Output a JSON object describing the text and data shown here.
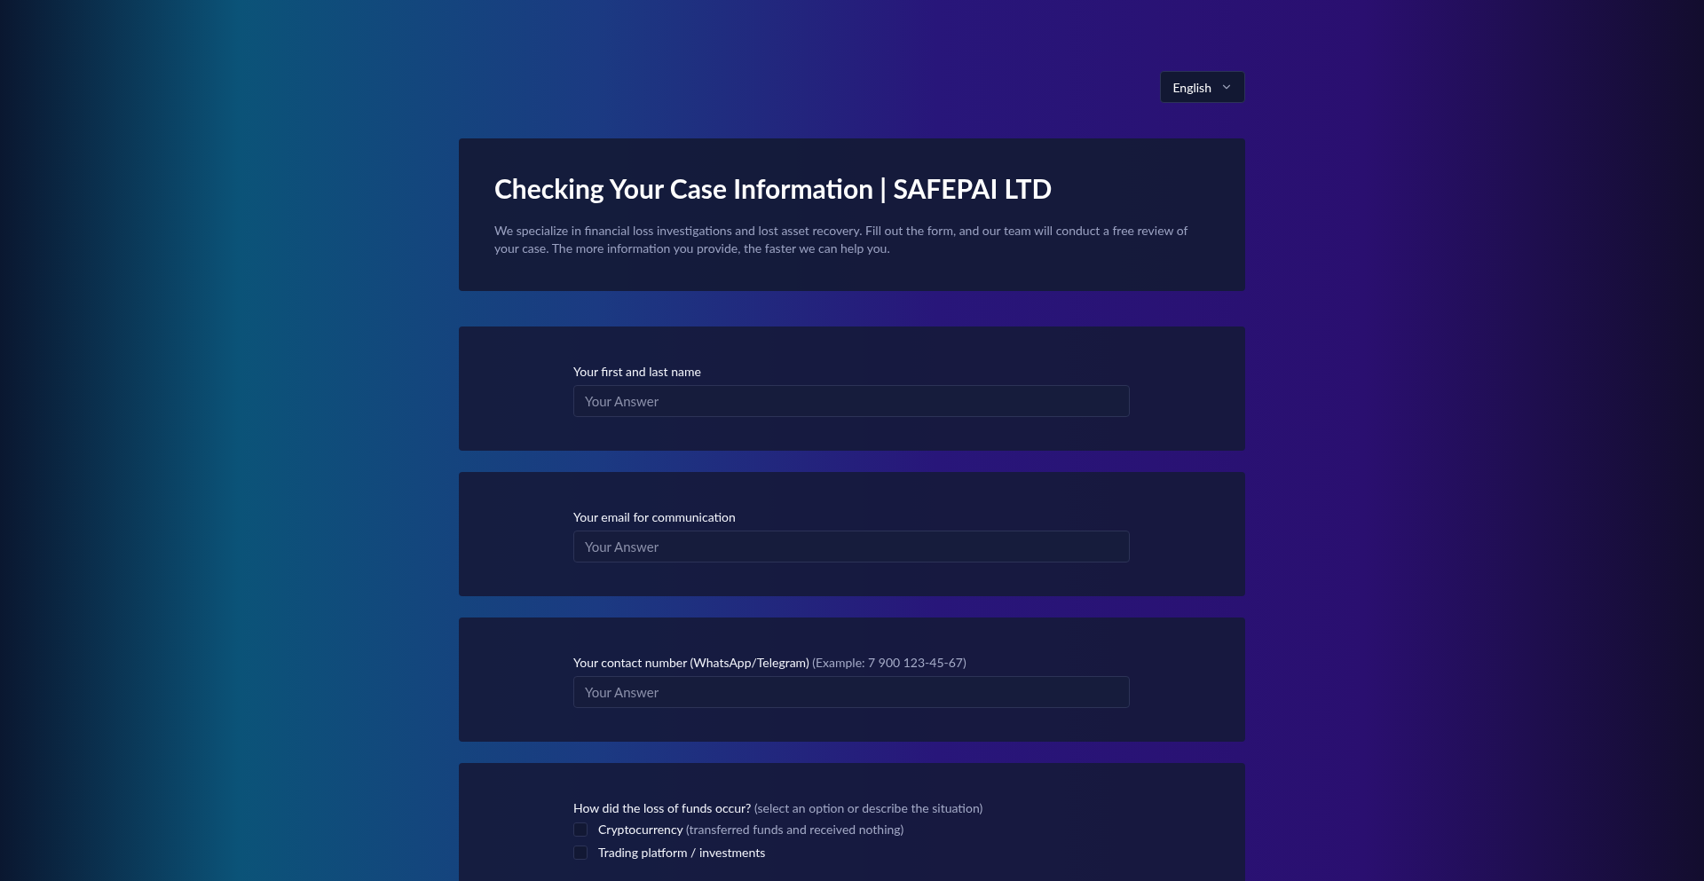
{
  "language": {
    "label": "English"
  },
  "header": {
    "title": "Checking Your Case Information | SAFEPAI LTD",
    "description": "We specialize in financial loss investigations and lost asset recovery. Fill out the form, and our team will conduct a free review of your case. The more information you provide, the faster we can help you."
  },
  "questions": [
    {
      "kind": "text",
      "label": "Your first and last name",
      "placeholder": "Your Answer"
    },
    {
      "kind": "text",
      "label": "Your email for communication",
      "placeholder": "Your Answer"
    },
    {
      "kind": "text",
      "label": "Your contact number (WhatsApp/Telegram)",
      "hint": "(Example: 7 900 123-45-67)",
      "placeholder": "Your Answer"
    },
    {
      "kind": "checkboxes",
      "label": "How did the loss of funds occur?",
      "hint": "(select an option or describe the situation)",
      "options": [
        {
          "label": "Cryptocurrency",
          "hint": "(transferred funds and received nothing)",
          "checked": false
        },
        {
          "label": "Trading platform / investments",
          "checked": false
        }
      ]
    }
  ]
}
